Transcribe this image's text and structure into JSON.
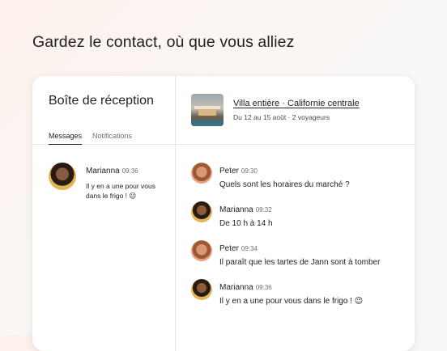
{
  "headline": "Gardez le contact, où que vous alliez",
  "inbox": {
    "title": "Boîte de réception",
    "tabs": [
      {
        "label": "Messages",
        "active": true
      },
      {
        "label": "Notifications",
        "active": false
      }
    ],
    "threads": [
      {
        "sender": "Marianna",
        "time": "09:36",
        "preview": "Il y en a une pour vous dans le frigo ! 😉"
      }
    ]
  },
  "listing": {
    "title": "Villa entière · Californie centrale",
    "subtitle": "Du 12 au 15 août · 2 voyageurs"
  },
  "messages": [
    {
      "sender": "Peter",
      "time": "09:30",
      "text": "Quels sont les horaires du marché ?",
      "avatar": "peter"
    },
    {
      "sender": "Marianna",
      "time": "09:32",
      "text": "De 10 h à 14 h",
      "avatar": "marianna"
    },
    {
      "sender": "Peter",
      "time": "09:34",
      "text": "Il paraît que les tartes de Jann sont à tomber",
      "avatar": "peter"
    },
    {
      "sender": "Marianna",
      "time": "09:36",
      "text": "Il y en a une pour vous dans le frigo ! 😉",
      "avatar": "marianna"
    }
  ]
}
